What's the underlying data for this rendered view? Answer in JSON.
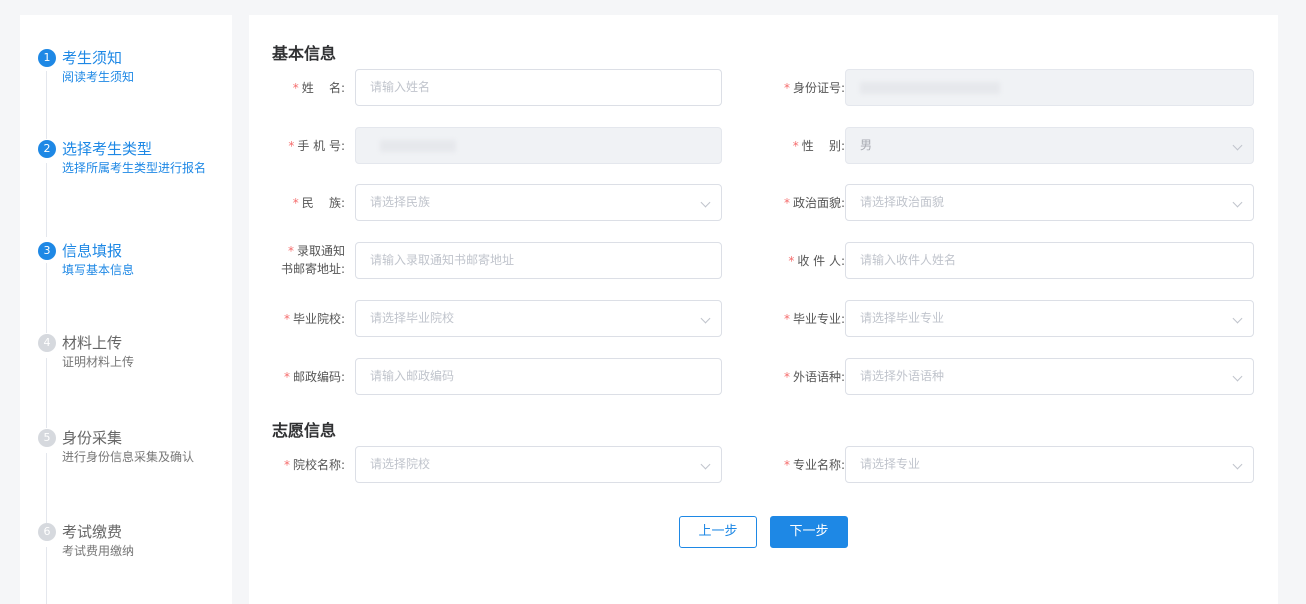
{
  "steps": [
    {
      "num": "1",
      "title": "考生须知",
      "desc": "阅读考生须知",
      "state": "active"
    },
    {
      "num": "2",
      "title": "选择考生类型",
      "desc": "选择所属考生类型进行报名",
      "state": "active"
    },
    {
      "num": "3",
      "title": "信息填报",
      "desc": "填写基本信息",
      "state": "active"
    },
    {
      "num": "4",
      "title": "材料上传",
      "desc": "证明材料上传",
      "state": "inactive"
    },
    {
      "num": "5",
      "title": "身份采集",
      "desc": "进行身份信息采集及确认",
      "state": "inactive"
    },
    {
      "num": "6",
      "title": "考试缴费",
      "desc": "考试费用缴纳",
      "state": "inactive"
    }
  ],
  "sections": {
    "basic": "基本信息",
    "preference": "志愿信息"
  },
  "form": {
    "name": {
      "label": "姓    名:",
      "placeholder": "请输入姓名"
    },
    "id_card": {
      "label": "身份证号:",
      "value": ""
    },
    "phone": {
      "label": "手 机 号:",
      "value": ""
    },
    "gender": {
      "label": "性    别:",
      "value": "男"
    },
    "ethnicity": {
      "label": "民    族:",
      "placeholder": "请选择民族"
    },
    "political": {
      "label": "政治面貌:",
      "placeholder": "请选择政治面貌"
    },
    "mail_address": {
      "label_line1": "录取通知",
      "label_line2": "书邮寄地址:",
      "placeholder": "请输入录取通知书邮寄地址"
    },
    "recipient": {
      "label": "收 件 人:",
      "placeholder": "请输入收件人姓名"
    },
    "grad_school": {
      "label": "毕业院校:",
      "placeholder": "请选择毕业院校"
    },
    "grad_major": {
      "label": "毕业专业:",
      "placeholder": "请选择毕业专业"
    },
    "postcode": {
      "label": "邮政编码:",
      "placeholder": "请输入邮政编码"
    },
    "language": {
      "label": "外语语种:",
      "placeholder": "请选择外语语种"
    },
    "school": {
      "label": "院校名称:",
      "placeholder": "请选择院校"
    },
    "major": {
      "label": "专业名称:",
      "placeholder": "请选择专业"
    }
  },
  "required_mark": "*",
  "buttons": {
    "prev": "上一步",
    "next": "下一步"
  },
  "colors": {
    "primary": "#1e88e5",
    "required": "#f56c6c",
    "inactive_step": "#d6d9de"
  }
}
